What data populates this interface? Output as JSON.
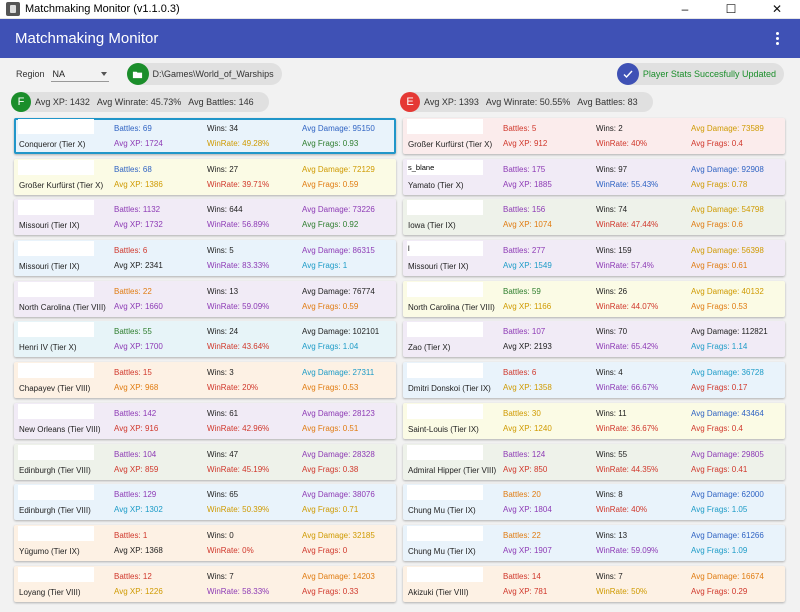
{
  "window": {
    "title": "Matchmaking Monitor (v1.1.0.3)",
    "minimize": "–",
    "maximize": "☐",
    "close": "✕"
  },
  "appbar": {
    "title": "Matchmaking Monitor"
  },
  "toolbar": {
    "region_label": "Region",
    "region_value": "NA",
    "game_path": "D:\\Games\\World_of_Warships",
    "status": "Player Stats Succesfully Updated"
  },
  "colors": {
    "appbar": "#3f51b5",
    "friendly": "#1b8e2b",
    "enemy": "#e53935",
    "selected_border": "#2196c9"
  },
  "friendly": {
    "badge": "F",
    "avg_xp": "Avg XP: 1432",
    "avg_winrate": "Avg Winrate: 45.73%",
    "avg_battles": "Avg Battles: 146",
    "players": [
      {
        "name": "",
        "ship": "Conqueror (Tier X)",
        "battles": "Battles: 69",
        "wins": "Wins: 34",
        "avg_damage": "Avg Damage: 95150",
        "avg_xp": "Avg XP: 1724",
        "winrate": "WinRate: 49.28%",
        "avg_frags": "Avg Frags: 0.93",
        "theme": "blue",
        "c_battles": "blue",
        "c_damage": "blue",
        "c_xp": "purple",
        "c_winrate": "gold",
        "c_frags": "green",
        "selected": true
      },
      {
        "name": "",
        "ship": "Großer Kurfürst (Tier X)",
        "battles": "Battles: 68",
        "wins": "Wins: 27",
        "avg_damage": "Avg Damage: 72129",
        "avg_xp": "Avg XP: 1386",
        "winrate": "WinRate: 39.71%",
        "avg_frags": "Avg Frags: 0.59",
        "theme": "yellow",
        "c_battles": "blue",
        "c_damage": "gold",
        "c_xp": "gold",
        "c_winrate": "red",
        "c_frags": "orange"
      },
      {
        "name": "",
        "ship": "Missouri (Tier IX)",
        "battles": "Battles: 1132",
        "wins": "Wins: 644",
        "avg_damage": "Avg Damage: 73226",
        "avg_xp": "Avg XP: 1732",
        "winrate": "WinRate: 56.89%",
        "avg_frags": "Avg Frags: 0.92",
        "theme": "purple",
        "c_battles": "purple",
        "c_damage": "purple",
        "c_xp": "purple",
        "c_winrate": "purple",
        "c_frags": "green"
      },
      {
        "name": "",
        "ship": "Missouri (Tier IX)",
        "battles": "Battles: 6",
        "wins": "Wins: 5",
        "avg_damage": "Avg Damage: 86315",
        "avg_xp": "Avg XP: 2341",
        "winrate": "WinRate: 83.33%",
        "avg_frags": "Avg Frags: 1",
        "theme": "blue",
        "c_battles": "red",
        "c_damage": "purple",
        "c_xp": "black",
        "c_winrate": "purple",
        "c_frags": "cyan"
      },
      {
        "name": "",
        "ship": "North Carolina (Tier VIII)",
        "battles": "Battles: 22",
        "wins": "Wins: 13",
        "avg_damage": "Avg Damage: 76774",
        "avg_xp": "Avg XP: 1660",
        "winrate": "WinRate: 59.09%",
        "avg_frags": "Avg Frags: 0.59",
        "theme": "purple",
        "c_battles": "orange",
        "c_damage": "black",
        "c_xp": "purple",
        "c_winrate": "purple",
        "c_frags": "orange"
      },
      {
        "name": "",
        "ship": "Henri IV (Tier X)",
        "battles": "Battles: 55",
        "wins": "Wins: 24",
        "avg_damage": "Avg Damage: 102101",
        "avg_xp": "Avg XP: 1700",
        "winrate": "WinRate: 43.64%",
        "avg_frags": "Avg Frags: 1.04",
        "theme": "cyan",
        "c_battles": "green",
        "c_damage": "black",
        "c_xp": "purple",
        "c_winrate": "red",
        "c_frags": "cyan"
      },
      {
        "name": "",
        "ship": "Chapayev (Tier VIII)",
        "battles": "Battles: 15",
        "wins": "Wins: 3",
        "avg_damage": "Avg Damage: 27311",
        "avg_xp": "Avg XP: 968",
        "winrate": "WinRate: 20%",
        "avg_frags": "Avg Frags: 0.53",
        "theme": "orange",
        "c_battles": "red",
        "c_damage": "cyan",
        "c_xp": "orange",
        "c_winrate": "red",
        "c_frags": "orange"
      },
      {
        "name": "",
        "ship": "New Orleans (Tier VIII)",
        "battles": "Battles: 142",
        "wins": "Wins: 61",
        "avg_damage": "Avg Damage: 28123",
        "avg_xp": "Avg XP: 916",
        "winrate": "WinRate: 42.96%",
        "avg_frags": "Avg Frags: 0.51",
        "theme": "purple",
        "c_battles": "purple",
        "c_damage": "purple",
        "c_xp": "red",
        "c_winrate": "red",
        "c_frags": "orange"
      },
      {
        "name": "",
        "ship": "Edinburgh (Tier VIII)",
        "battles": "Battles: 104",
        "wins": "Wins: 47",
        "avg_damage": "Avg Damage: 28328",
        "avg_xp": "Avg XP: 859",
        "winrate": "WinRate: 45.19%",
        "avg_frags": "Avg Frags: 0.38",
        "theme": "green",
        "c_battles": "purple",
        "c_damage": "purple",
        "c_xp": "red",
        "c_winrate": "red",
        "c_frags": "red"
      },
      {
        "name": "",
        "ship": "Edinburgh (Tier VIII)",
        "battles": "Battles: 129",
        "wins": "Wins: 65",
        "avg_damage": "Avg Damage: 38076",
        "avg_xp": "Avg XP: 1302",
        "winrate": "WinRate: 50.39%",
        "avg_frags": "Avg Frags: 0.71",
        "theme": "blue",
        "c_battles": "purple",
        "c_damage": "purple",
        "c_xp": "cyan",
        "c_winrate": "gold",
        "c_frags": "gold"
      },
      {
        "name": "",
        "ship": "Yūgumo (Tier IX)",
        "battles": "Battles: 1",
        "wins": "Wins: 0",
        "avg_damage": "Avg Damage: 32185",
        "avg_xp": "Avg XP: 1368",
        "winrate": "WinRate: 0%",
        "avg_frags": "Avg Frags: 0",
        "theme": "orange",
        "c_battles": "red",
        "c_damage": "gold",
        "c_xp": "black",
        "c_winrate": "red",
        "c_frags": "red"
      },
      {
        "name": "",
        "ship": "Loyang (Tier VIII)",
        "battles": "Battles: 12",
        "wins": "Wins: 7",
        "avg_damage": "Avg Damage: 14203",
        "avg_xp": "Avg XP: 1226",
        "winrate": "WinRate: 58.33%",
        "avg_frags": "Avg Frags: 0.33",
        "theme": "orange",
        "c_battles": "red",
        "c_damage": "orange",
        "c_xp": "gold",
        "c_winrate": "purple",
        "c_frags": "red"
      }
    ]
  },
  "enemy": {
    "badge": "E",
    "avg_xp": "Avg XP: 1393",
    "avg_winrate": "Avg Winrate: 50.55%",
    "avg_battles": "Avg Battles: 83",
    "players": [
      {
        "name": "",
        "ship": "Großer Kurfürst (Tier X)",
        "battles": "Battles: 5",
        "wins": "Wins: 2",
        "avg_damage": "Avg Damage: 73589",
        "avg_xp": "Avg XP: 912",
        "winrate": "WinRate: 40%",
        "avg_frags": "Avg Frags: 0.4",
        "theme": "red",
        "c_battles": "red",
        "c_damage": "gold",
        "c_xp": "red",
        "c_winrate": "red",
        "c_frags": "red"
      },
      {
        "name": "s_blane",
        "ship": "Yamato (Tier X)",
        "battles": "Battles: 175",
        "wins": "Wins: 97",
        "avg_damage": "Avg Damage: 92908",
        "avg_xp": "Avg XP: 1885",
        "winrate": "WinRate: 55.43%",
        "avg_frags": "Avg Frags: 0.78",
        "theme": "purple",
        "c_battles": "purple",
        "c_damage": "blue",
        "c_xp": "purple",
        "c_winrate": "blue",
        "c_frags": "gold"
      },
      {
        "name": "",
        "ship": "Iowa (Tier IX)",
        "battles": "Battles: 156",
        "wins": "Wins: 74",
        "avg_damage": "Avg Damage: 54798",
        "avg_xp": "Avg XP: 1074",
        "winrate": "WinRate: 47.44%",
        "avg_frags": "Avg Frags: 0.6",
        "theme": "green",
        "c_battles": "purple",
        "c_damage": "gold",
        "c_xp": "orange",
        "c_winrate": "red",
        "c_frags": "orange"
      },
      {
        "name": "l",
        "ship": "Missouri (Tier IX)",
        "battles": "Battles: 277",
        "wins": "Wins: 159",
        "avg_damage": "Avg Damage: 56398",
        "avg_xp": "Avg XP: 1549",
        "winrate": "WinRate: 57.4%",
        "avg_frags": "Avg Frags: 0.61",
        "theme": "purple",
        "c_battles": "purple",
        "c_damage": "gold",
        "c_xp": "cyan",
        "c_winrate": "purple",
        "c_frags": "orange"
      },
      {
        "name": "",
        "ship": "North Carolina (Tier VIII)",
        "battles": "Battles: 59",
        "wins": "Wins: 26",
        "avg_damage": "Avg Damage: 40132",
        "avg_xp": "Avg XP: 1166",
        "winrate": "WinRate: 44.07%",
        "avg_frags": "Avg Frags: 0.53",
        "theme": "yellow",
        "c_battles": "green",
        "c_damage": "gold",
        "c_xp": "gold",
        "c_winrate": "red",
        "c_frags": "orange"
      },
      {
        "name": "",
        "ship": "Zao (Tier X)",
        "battles": "Battles: 107",
        "wins": "Wins: 70",
        "avg_damage": "Avg Damage: 112821",
        "avg_xp": "Avg XP: 2193",
        "winrate": "WinRate: 65.42%",
        "avg_frags": "Avg Frags: 1.14",
        "theme": "purple",
        "c_battles": "purple",
        "c_damage": "black",
        "c_xp": "black",
        "c_winrate": "purple",
        "c_frags": "cyan"
      },
      {
        "name": "",
        "ship": "Dmitri Donskoi (Tier IX)",
        "battles": "Battles: 6",
        "wins": "Wins: 4",
        "avg_damage": "Avg Damage: 36728",
        "avg_xp": "Avg XP: 1358",
        "winrate": "WinRate: 66.67%",
        "avg_frags": "Avg Frags: 0.17",
        "theme": "blue",
        "c_battles": "red",
        "c_damage": "cyan",
        "c_xp": "gold",
        "c_winrate": "purple",
        "c_frags": "red"
      },
      {
        "name": "",
        "ship": "Saint-Louis (Tier IX)",
        "battles": "Battles: 30",
        "wins": "Wins: 11",
        "avg_damage": "Avg Damage: 43464",
        "avg_xp": "Avg XP: 1240",
        "winrate": "WinRate: 36.67%",
        "avg_frags": "Avg Frags: 0.4",
        "theme": "yellow",
        "c_battles": "gold",
        "c_damage": "blue",
        "c_xp": "gold",
        "c_winrate": "red",
        "c_frags": "red"
      },
      {
        "name": "",
        "ship": "Admiral Hipper (Tier VIII)",
        "battles": "Battles: 124",
        "wins": "Wins: 55",
        "avg_damage": "Avg Damage: 29805",
        "avg_xp": "Avg XP: 850",
        "winrate": "WinRate: 44.35%",
        "avg_frags": "Avg Frags: 0.41",
        "theme": "green",
        "c_battles": "purple",
        "c_damage": "purple",
        "c_xp": "red",
        "c_winrate": "red",
        "c_frags": "red"
      },
      {
        "name": "",
        "ship": "Chung Mu (Tier IX)",
        "battles": "Battles: 20",
        "wins": "Wins: 8",
        "avg_damage": "Avg Damage: 62000",
        "avg_xp": "Avg XP: 1804",
        "winrate": "WinRate: 40%",
        "avg_frags": "Avg Frags: 1.05",
        "theme": "blue",
        "c_battles": "orange",
        "c_damage": "blue",
        "c_xp": "purple",
        "c_winrate": "red",
        "c_frags": "cyan"
      },
      {
        "name": "",
        "ship": "Chung Mu (Tier IX)",
        "battles": "Battles: 22",
        "wins": "Wins: 13",
        "avg_damage": "Avg Damage: 61266",
        "avg_xp": "Avg XP: 1907",
        "winrate": "WinRate: 59.09%",
        "avg_frags": "Avg Frags: 1.09",
        "theme": "blue",
        "c_battles": "orange",
        "c_damage": "blue",
        "c_xp": "purple",
        "c_winrate": "purple",
        "c_frags": "cyan"
      },
      {
        "name": "",
        "ship": "Akizuki (Tier VIII)",
        "battles": "Battles: 14",
        "wins": "Wins: 7",
        "avg_damage": "Avg Damage: 16674",
        "avg_xp": "Avg XP: 781",
        "winrate": "WinRate: 50%",
        "avg_frags": "Avg Frags: 0.29",
        "theme": "orange",
        "c_battles": "red",
        "c_damage": "orange",
        "c_xp": "red",
        "c_winrate": "gold",
        "c_frags": "red"
      }
    ]
  }
}
